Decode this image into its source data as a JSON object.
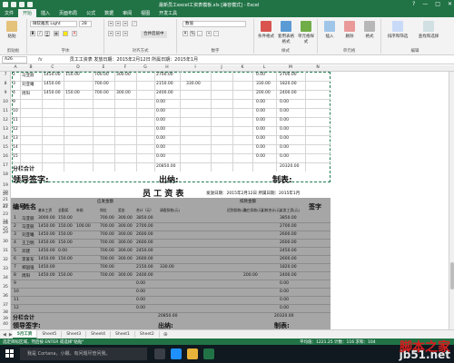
{
  "title_bar": {
    "title": "最新员工excel工资表模板.xls [兼容模式] - Excel",
    "controls": [
      "?",
      "—",
      "□",
      "✕"
    ]
  },
  "ribbon_tabs": [
    "文件",
    "开始",
    "插入",
    "页面布局",
    "公式",
    "数据",
    "审阅",
    "视图",
    "开发工具"
  ],
  "active_tab": "开始",
  "ribbon": {
    "paste": "粘贴",
    "font_name": "微软雅黑 Light",
    "font_size": "28",
    "number_format": "数值",
    "groups": [
      "剪贴板",
      "字体",
      "对齐方式",
      "数字",
      "样式",
      "单元格",
      "编辑"
    ],
    "conditional_format": "条件格式",
    "table_format": "套用表格格式",
    "cell_style": "单元格样式",
    "insert": "插入",
    "delete": "删除",
    "format": "格式",
    "sort_filter": "排序和筛选",
    "find_select": "查找和选择",
    "merge": "合并后居中"
  },
  "formula_bar": {
    "name_box": "A26",
    "fx": "fx",
    "content": "员工工资表   发放日期：2015年2月12日   所属日期：2015年1月"
  },
  "columns": [
    "A",
    "B",
    "C",
    "D",
    "E",
    "F",
    "G",
    "H",
    "I",
    "J",
    "K",
    "L",
    "M",
    "N"
  ],
  "upper_rows": [
    {
      "row": "7",
      "idx": "2",
      "name": "马亚丽",
      "c": "1450.00",
      "d": "150.00",
      "f": "700.00",
      "g": "300.00",
      "h": "2700.00",
      "j": "",
      "l": "0.00",
      "m": "2700.00"
    },
    {
      "row": "8",
      "idx": "3",
      "name": "刘亚曦",
      "c": "1450.00",
      "d": "",
      "f": "700.00",
      "g": "",
      "h": "2150.00",
      "j": "330.00",
      "l": "330.00",
      "m": "1820.00"
    },
    {
      "row": "9",
      "idx": "4",
      "name": "周阳",
      "c": "1450.00",
      "d": "150.00",
      "f": "700.00",
      "g": "300.00",
      "h": "2400.00",
      "j": "",
      "l": "200.00",
      "m": "2400.00"
    },
    {
      "row": "10",
      "idx": "9",
      "name": "",
      "c": "",
      "d": "",
      "f": "",
      "g": "",
      "h": "0.00",
      "j": "",
      "l": "0.00",
      "m": "0.00"
    },
    {
      "row": "11",
      "idx": "10",
      "name": "",
      "c": "",
      "d": "",
      "f": "",
      "g": "",
      "h": "0.00",
      "j": "",
      "l": "0.00",
      "m": "0.00"
    },
    {
      "row": "12",
      "idx": "11",
      "name": "",
      "c": "",
      "d": "",
      "f": "",
      "g": "",
      "h": "0.00",
      "j": "",
      "l": "0.00",
      "m": "0.00"
    },
    {
      "row": "13",
      "idx": "12",
      "name": "",
      "c": "",
      "d": "",
      "f": "",
      "g": "",
      "h": "0.00",
      "j": "",
      "l": "0.00",
      "m": "0.00"
    },
    {
      "row": "14",
      "idx": "13",
      "name": "",
      "c": "",
      "d": "",
      "f": "",
      "g": "",
      "h": "0.00",
      "j": "",
      "l": "0.00",
      "m": "0.00"
    },
    {
      "row": "15",
      "idx": "14",
      "name": "",
      "c": "",
      "d": "",
      "f": "",
      "g": "",
      "h": "0.00",
      "j": "",
      "l": "0.00",
      "m": "0.00"
    },
    {
      "row": "16",
      "idx": "15",
      "name": "",
      "c": "",
      "d": "",
      "f": "",
      "g": "",
      "h": "0.00",
      "j": "",
      "l": "0.00",
      "m": "0.00"
    }
  ],
  "upper_footer": {
    "subtotal_row": "17",
    "subtotal_label": "分栏合计",
    "subtotal_total": "20850.00",
    "subtotal_net": "20320.00",
    "sign_row": "18",
    "leader_sign": "领导签字:",
    "cashier": "出纳:",
    "maker": "制表:",
    "blank_rows": [
      "19",
      "20",
      "21",
      "22",
      "23",
      "24",
      "25"
    ]
  },
  "lower": {
    "title_big": "员 工 资 表",
    "title_note": "发放日期：2015年2月12日  所属日期：2015年1月",
    "col_idx": "编号",
    "col_name": "姓名",
    "group_due": "应发金额",
    "group_deduct": "扣款金额",
    "signature": "签字",
    "sub_headers": [
      "基本工资",
      "全勤奖",
      "补助",
      "岗位",
      "奖金",
      "合计（元）",
      "请假扣款(元)",
      "迟到扣款(元)",
      "其它扣款(元)",
      "扣款合计(元)",
      "实发工资(元)"
    ],
    "rows": [
      {
        "row": "28",
        "idx": "1",
        "name": "马亚丽",
        "a": "3000.00",
        "b": "150.00",
        "c": "",
        "d": "700.00",
        "e": "300.00",
        "tot": "3850.00",
        "net": "3850.00"
      },
      {
        "row": "29",
        "idx": "2",
        "name": "马亚丽",
        "a": "1450.00",
        "b": "150.00",
        "c": "100.00",
        "d": "700.00",
        "e": "300.00",
        "tot": "2700.00",
        "net": "2700.00"
      },
      {
        "row": "30",
        "idx": "3",
        "name": "刘亚曦",
        "a": "1450.00",
        "b": "150.00",
        "c": "",
        "d": "700.00",
        "e": "300.00",
        "tot": "2600.00",
        "net": "2600.00"
      },
      {
        "row": "31",
        "idx": "4",
        "name": "王卫明",
        "a": "1450.00",
        "b": "150.00",
        "c": "",
        "d": "700.00",
        "e": "300.00",
        "tot": "2600.00",
        "net": "2600.00"
      },
      {
        "row": "32",
        "idx": "5",
        "name": "邓建",
        "a": "1450.00",
        "b": "0.00",
        "c": "",
        "d": "700.00",
        "e": "300.00",
        "tot": "2450.00",
        "net": "2450.00"
      },
      {
        "row": "33",
        "idx": "6",
        "name": "李爱军",
        "a": "1450.00",
        "b": "150.00",
        "c": "",
        "d": "700.00",
        "e": "300.00",
        "tot": "2600.00",
        "net": "2600.00"
      },
      {
        "row": "34",
        "idx": "7",
        "name": "郑国强",
        "a": "1450.00",
        "b": "",
        "c": "",
        "d": "700.00",
        "e": "",
        "tot": "2150.00",
        "deduct": "330.00",
        "net": "1820.00"
      },
      {
        "row": "35",
        "idx": "8",
        "name": "周阳",
        "a": "1450.00",
        "b": "150.00",
        "c": "",
        "d": "700.00",
        "e": "300.00",
        "tot": "2400.00",
        "other": "200.00",
        "net": "2400.00"
      },
      {
        "row": "36",
        "idx": "9",
        "name": "",
        "tot": "0.00",
        "net": "0.00"
      },
      {
        "row": "37",
        "idx": "10",
        "name": "",
        "tot": "0.00",
        "net": "0.00"
      },
      {
        "row": "38",
        "idx": "11",
        "name": "",
        "tot": "0.00",
        "net": "0.00"
      },
      {
        "row": "39",
        "idx": "12",
        "name": "",
        "tot": "0.00",
        "net": "0.00"
      }
    ],
    "subtotal_row": "40",
    "subtotal_label": "分栏合计",
    "subtotal_total": "20850.00",
    "subtotal_net": "20320.00",
    "sign_row": "41",
    "leader_sign": "领导签字:",
    "cashier": "出纳:",
    "maker": "制表:",
    "header_rows": [
      "26",
      "27"
    ]
  },
  "sheet_tabs": [
    "5月工资",
    "Sheet5",
    "Sheet3",
    "Sheet4",
    "Sheet1",
    "Sheet2"
  ],
  "active_sheet": "5月工资",
  "status": {
    "left": "选定目标区域，然后按 ENTER 或选择\"粘贴\"",
    "right": "平均值：1221.25   计数：116   求和：104"
  },
  "taskbar": {
    "search": "我是 Cortana，小娜。有问题尽管问我。"
  },
  "watermark": {
    "line1": "jb51.net",
    "line2": "脚本之家"
  },
  "colors": {
    "excel_green": "#217346",
    "accent_red": "#d61e1e"
  }
}
